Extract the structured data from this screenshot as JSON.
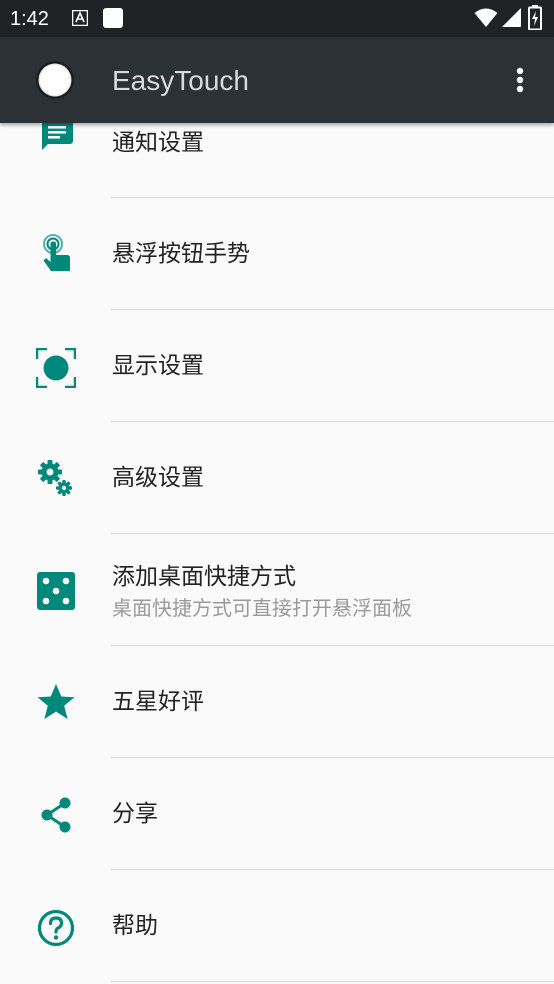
{
  "status_bar": {
    "time": "1:42"
  },
  "app_bar": {
    "title": "EasyTouch"
  },
  "colors": {
    "accent": "#00897b",
    "app_bar": "#2b3134",
    "status_bar": "#1f2325"
  },
  "items": [
    {
      "title": "通知设置",
      "icon": "notification-message-icon"
    },
    {
      "title": "悬浮按钮手势",
      "icon": "touch-gesture-icon"
    },
    {
      "title": "显示设置",
      "icon": "display-icon"
    },
    {
      "title": "高级设置",
      "icon": "gears-icon"
    },
    {
      "title": "添加桌面快捷方式",
      "subtitle": "桌面快捷方式可直接打开悬浮面板",
      "icon": "dice-icon"
    },
    {
      "title": "五星好评",
      "icon": "star-icon"
    },
    {
      "title": "分享",
      "icon": "share-icon"
    },
    {
      "title": "帮助",
      "icon": "help-icon"
    }
  ]
}
